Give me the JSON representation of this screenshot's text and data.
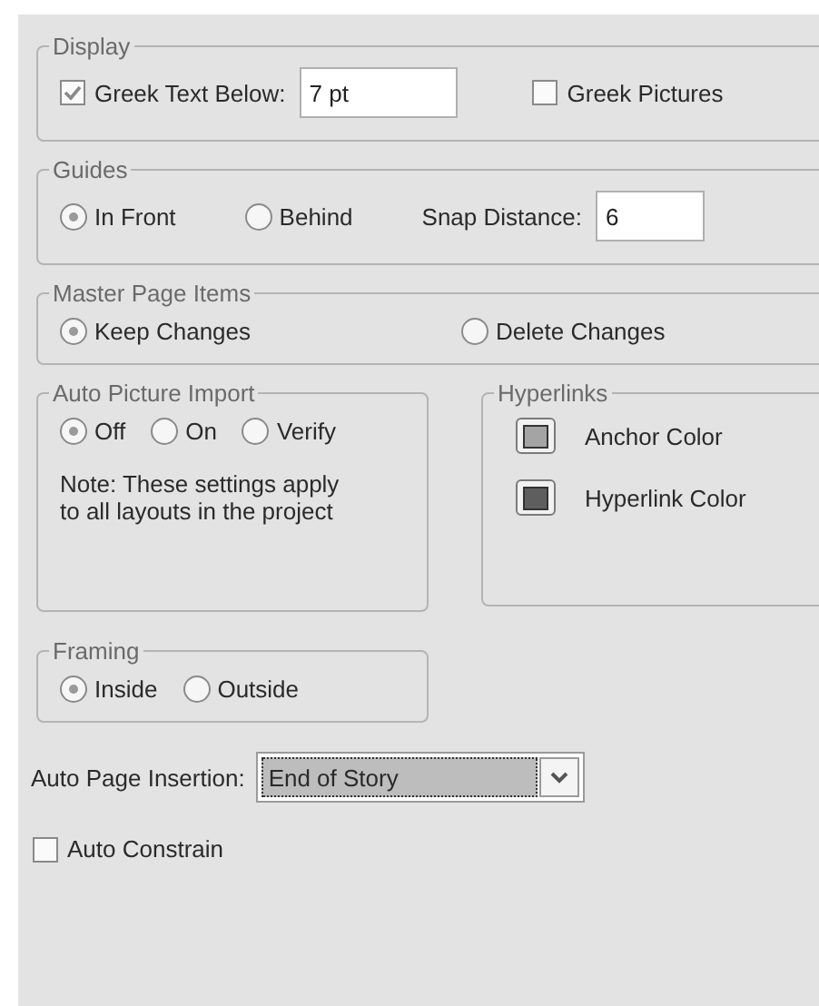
{
  "display": {
    "title": "Display",
    "greek_text": {
      "label": "Greek Text Below:",
      "checked": true,
      "value": "7 pt"
    },
    "greek_pictures": {
      "label": "Greek Pictures",
      "checked": false
    }
  },
  "guides": {
    "title": "Guides",
    "options": [
      {
        "label": "In Front",
        "selected": true
      },
      {
        "label": "Behind",
        "selected": false
      }
    ],
    "snap_distance": {
      "label": "Snap Distance:",
      "value": "6"
    }
  },
  "master_page_items": {
    "title": "Master Page Items",
    "options": [
      {
        "label": "Keep Changes",
        "selected": true
      },
      {
        "label": "Delete Changes",
        "selected": false
      }
    ]
  },
  "auto_picture_import": {
    "title": "Auto Picture Import",
    "options": [
      {
        "label": "Off",
        "selected": true
      },
      {
        "label": "On",
        "selected": false
      },
      {
        "label": "Verify",
        "selected": false
      }
    ],
    "note": "Note: These settings apply to all layouts in the project"
  },
  "hyperlinks": {
    "title": "Hyperlinks",
    "items": [
      {
        "label": "Anchor Color",
        "color": "#a4a4a4"
      },
      {
        "label": "Hyperlink Color",
        "color": "#5e5e5e"
      }
    ]
  },
  "framing": {
    "title": "Framing",
    "options": [
      {
        "label": "Inside",
        "selected": true
      },
      {
        "label": "Outside",
        "selected": false
      }
    ]
  },
  "auto_page_insertion": {
    "label": "Auto Page Insertion:",
    "value": "End of Story"
  },
  "auto_constrain": {
    "label": "Auto Constrain",
    "checked": false
  }
}
